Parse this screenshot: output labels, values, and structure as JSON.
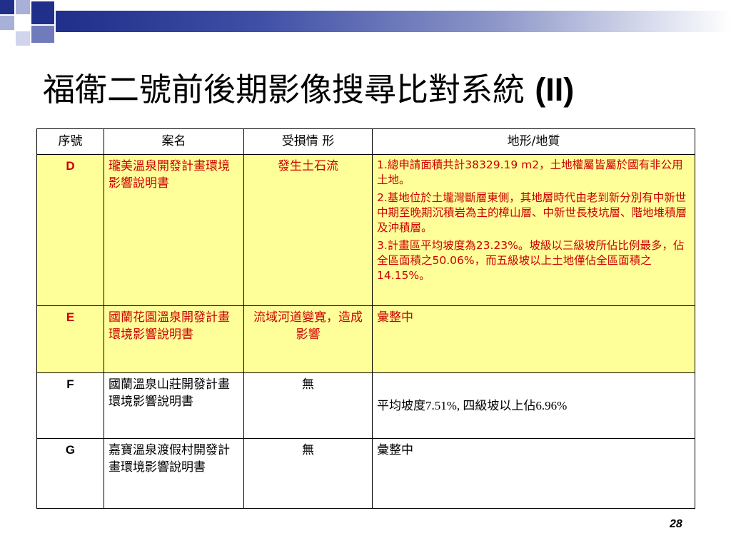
{
  "slide": {
    "title_cjk": "福衛二號前後期影像搜尋比對系統 ",
    "title_latin": "(II)",
    "page_number": "28"
  },
  "table": {
    "headers": {
      "col1": "序號",
      "col2": "案名",
      "col3": "受損情 形",
      "col4": "地形/地質"
    },
    "rows": [
      {
        "id": "D",
        "name": "瓏美溫泉開發計畫環境影響說明書",
        "damage": "發生土石流",
        "geology": [
          "1.總申請面積共計38329.19 m2，土地權屬皆屬於國有非公用土地。",
          "2.基地位於土壠灣斷層東側，其地層時代由老到新分別有中新世中期至晚期沉積岩為主的樟山層、中新世長枝坑層、階地堆積層及沖積層。",
          "3.計畫區平均坡度為23.23%。坡級以三級坡所佔比例最多，佔全區面積之50.06%，而五級坡以上土地僅佔全區面積之14.15%。"
        ]
      },
      {
        "id": "E",
        "name": "國蘭花園溫泉開發計畫環境影響說明書",
        "damage": "流域河道變寬，造成影響",
        "geology_text": "彙整中"
      },
      {
        "id": "F",
        "name": "國蘭溫泉山莊開發計畫環境影響說明書",
        "damage": "無",
        "geology_text": "平均坡度7.51%, 四級坡以上佔6.96%"
      },
      {
        "id": "G",
        "name": "嘉寶溫泉渡假村開發計畫環境影響說明書",
        "damage": "無",
        "geology_text": "彙整中"
      }
    ]
  },
  "colors": {
    "highlight_row": "#ffff99",
    "highlight_text": "#cc0000",
    "accent_blue": "#1f2f8a"
  }
}
